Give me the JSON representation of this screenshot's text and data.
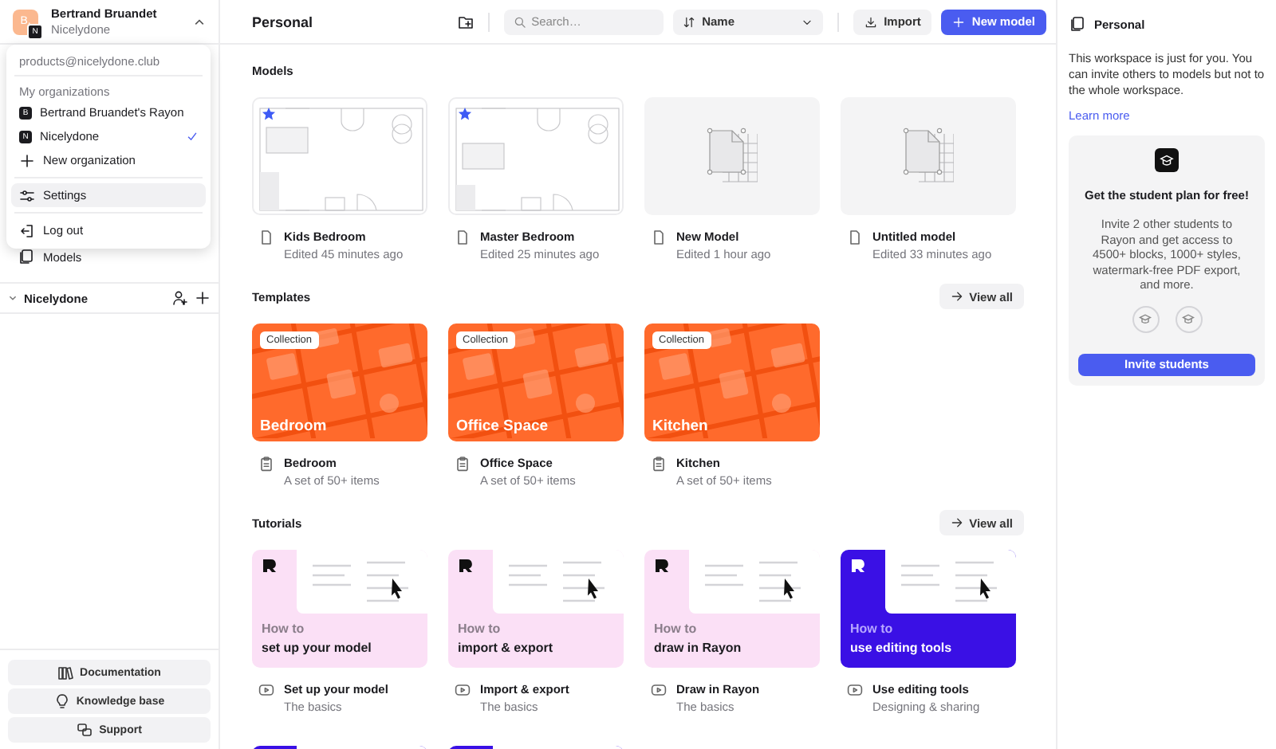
{
  "account": {
    "avatar_letter": "B.",
    "org_letter": "N",
    "name": "Bertrand Bruandet",
    "org": "Nicelydone",
    "expanded": true
  },
  "account_menu": {
    "email": "products@nicelydone.club",
    "section": "My organizations",
    "organizations": [
      {
        "badge": "B",
        "name": "Bertrand Bruandet's Rayon",
        "selected": false
      },
      {
        "badge": "N",
        "name": "Nicelydone",
        "selected": true
      }
    ],
    "items": [
      {
        "kind": "add",
        "label": "New organization",
        "selected": false
      },
      {
        "kind": "settings",
        "label": "Settings",
        "selected": true
      },
      {
        "kind": "logout",
        "label": "Log out",
        "selected": false
      }
    ]
  },
  "sidebar": {
    "items": [
      {
        "label": "Models"
      }
    ],
    "workspace": {
      "name": "Nicelydone",
      "expanded": true
    },
    "footer_buttons": [
      {
        "kind": "docs",
        "label": "Documentation"
      },
      {
        "kind": "bulb",
        "label": "Knowledge base"
      },
      {
        "kind": "support",
        "label": "Support"
      }
    ]
  },
  "header": {
    "title": "Personal",
    "search": {
      "placeholder": "Search…"
    },
    "sort": {
      "label": "Name"
    },
    "import_label": "Import",
    "new_model_label": "New model"
  },
  "models": {
    "title": "Models",
    "items": [
      {
        "name": "Kids Bedroom",
        "edited": "Edited 45 minutes ago",
        "kind": "floorplan",
        "starred": true
      },
      {
        "name": "Master Bedroom",
        "edited": "Edited 25 minutes ago",
        "kind": "floorplan",
        "starred": true
      },
      {
        "name": "New Model",
        "edited": "Edited 1 hour ago",
        "kind": "blank",
        "starred": false
      },
      {
        "name": "Untitled model",
        "edited": "Edited 33 minutes ago",
        "kind": "blank",
        "starred": false
      }
    ]
  },
  "templates": {
    "title": "Templates",
    "view_all": "View all",
    "items": [
      {
        "badge": "Collection",
        "cover_title": "Bedroom",
        "name": "Bedroom",
        "subtitle": "A set of 50+ items"
      },
      {
        "badge": "Collection",
        "cover_title": "Office Space",
        "name": "Office Space",
        "subtitle": "A set of 50+ items"
      },
      {
        "badge": "Collection",
        "cover_title": "Kitchen",
        "name": "Kitchen",
        "subtitle": "A set of 50+ items"
      }
    ]
  },
  "tutorials": {
    "title": "Tutorials",
    "view_all": "View all",
    "items": [
      {
        "kind": "pink",
        "lead": "How to",
        "headline": "set up your model",
        "name": "Set up your model",
        "subtitle": "The basics"
      },
      {
        "kind": "pink",
        "lead": "How to",
        "headline": "import & export",
        "name": "Import & export",
        "subtitle": "The basics"
      },
      {
        "kind": "pink",
        "lead": "How to",
        "headline": "draw in Rayon",
        "name": "Draw in Rayon",
        "subtitle": "The basics"
      },
      {
        "kind": "blue",
        "lead": "How to",
        "headline": "use editing tools",
        "name": "Use editing tools",
        "subtitle": "Designing & sharing"
      },
      {
        "kind": "blue"
      },
      {
        "kind": "blue"
      }
    ]
  },
  "info_panel": {
    "title": "Personal",
    "description": "This workspace is just for you. You can invite others to models but not to the whole workspace.",
    "link": "Learn more",
    "promo": {
      "title": "Get the student plan for free!",
      "text": "Invite 2 other students to Rayon and get access to 4500+ blocks, 1000+ styles, watermark-free PDF export, and more.",
      "button": "Invite students"
    }
  }
}
